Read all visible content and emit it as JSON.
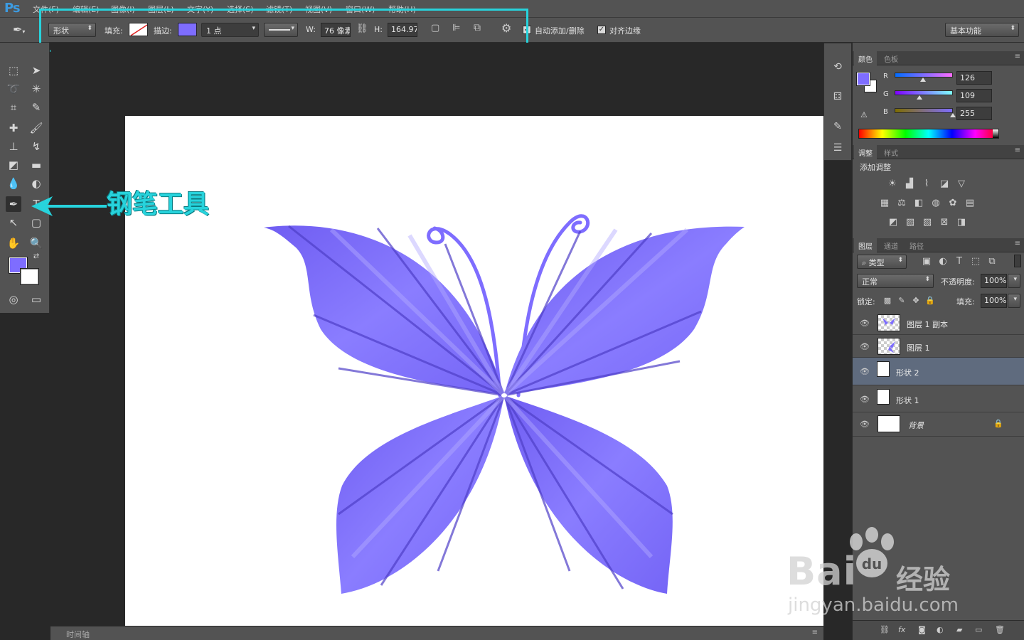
{
  "app": {
    "logo": "Ps"
  },
  "menu": [
    "文件(F)",
    "编辑(E)",
    "图像(I)",
    "图层(L)",
    "文字(Y)",
    "选择(S)",
    "滤镜(T)",
    "视图(V)",
    "窗口(W)",
    "帮助(H)"
  ],
  "options": {
    "mode": "形状",
    "fill_label": "填充:",
    "stroke_label": "描边:",
    "stroke_width": "1 点",
    "w_label": "W:",
    "w_value": "76 像素",
    "h_label": "H:",
    "h_value": "164.97",
    "auto_add_delete": "自动添加/删除",
    "align_edges": "对齐边缘",
    "workspace": "基本功能",
    "stroke_color": "#7e6dff"
  },
  "annotation": {
    "text": "钢笔工具",
    "color": "#27d3dc"
  },
  "color_panel": {
    "tabs": [
      "颜色",
      "色板"
    ],
    "r_label": "R",
    "g_label": "G",
    "b_label": "B",
    "r": "126",
    "g": "109",
    "b": "255",
    "foreground": "#7e6dff",
    "r_fraction": 0.49,
    "g_fraction": 0.43,
    "b_fraction": 1.0
  },
  "adjust_panel": {
    "tabs": [
      "调整",
      "样式"
    ],
    "title": "添加调整"
  },
  "layers_panel": {
    "tabs": [
      "图层",
      "通道",
      "路径"
    ],
    "filter_kind": "类型",
    "blend_mode": "正常",
    "opacity_label": "不透明度:",
    "opacity": "100%",
    "lock_label": "锁定:",
    "fill_label": "填充:",
    "fill": "100%",
    "layers": [
      {
        "name": "图层 1 副本",
        "type": "pixel"
      },
      {
        "name": "图层 1",
        "type": "pixel"
      },
      {
        "name": "形状 2",
        "type": "shape",
        "selected": true
      },
      {
        "name": "形状 1",
        "type": "shape"
      },
      {
        "name": "背景",
        "type": "background",
        "locked": true
      }
    ]
  },
  "timeline": {
    "label": "时间轴"
  },
  "watermark": {
    "brand": "Bai",
    "product": "经验",
    "url": "jingyan.baidu.com"
  },
  "colors": {
    "butterfly": "#7e6dff",
    "ui_bg": "#535353",
    "highlight": "#27d3dc"
  }
}
